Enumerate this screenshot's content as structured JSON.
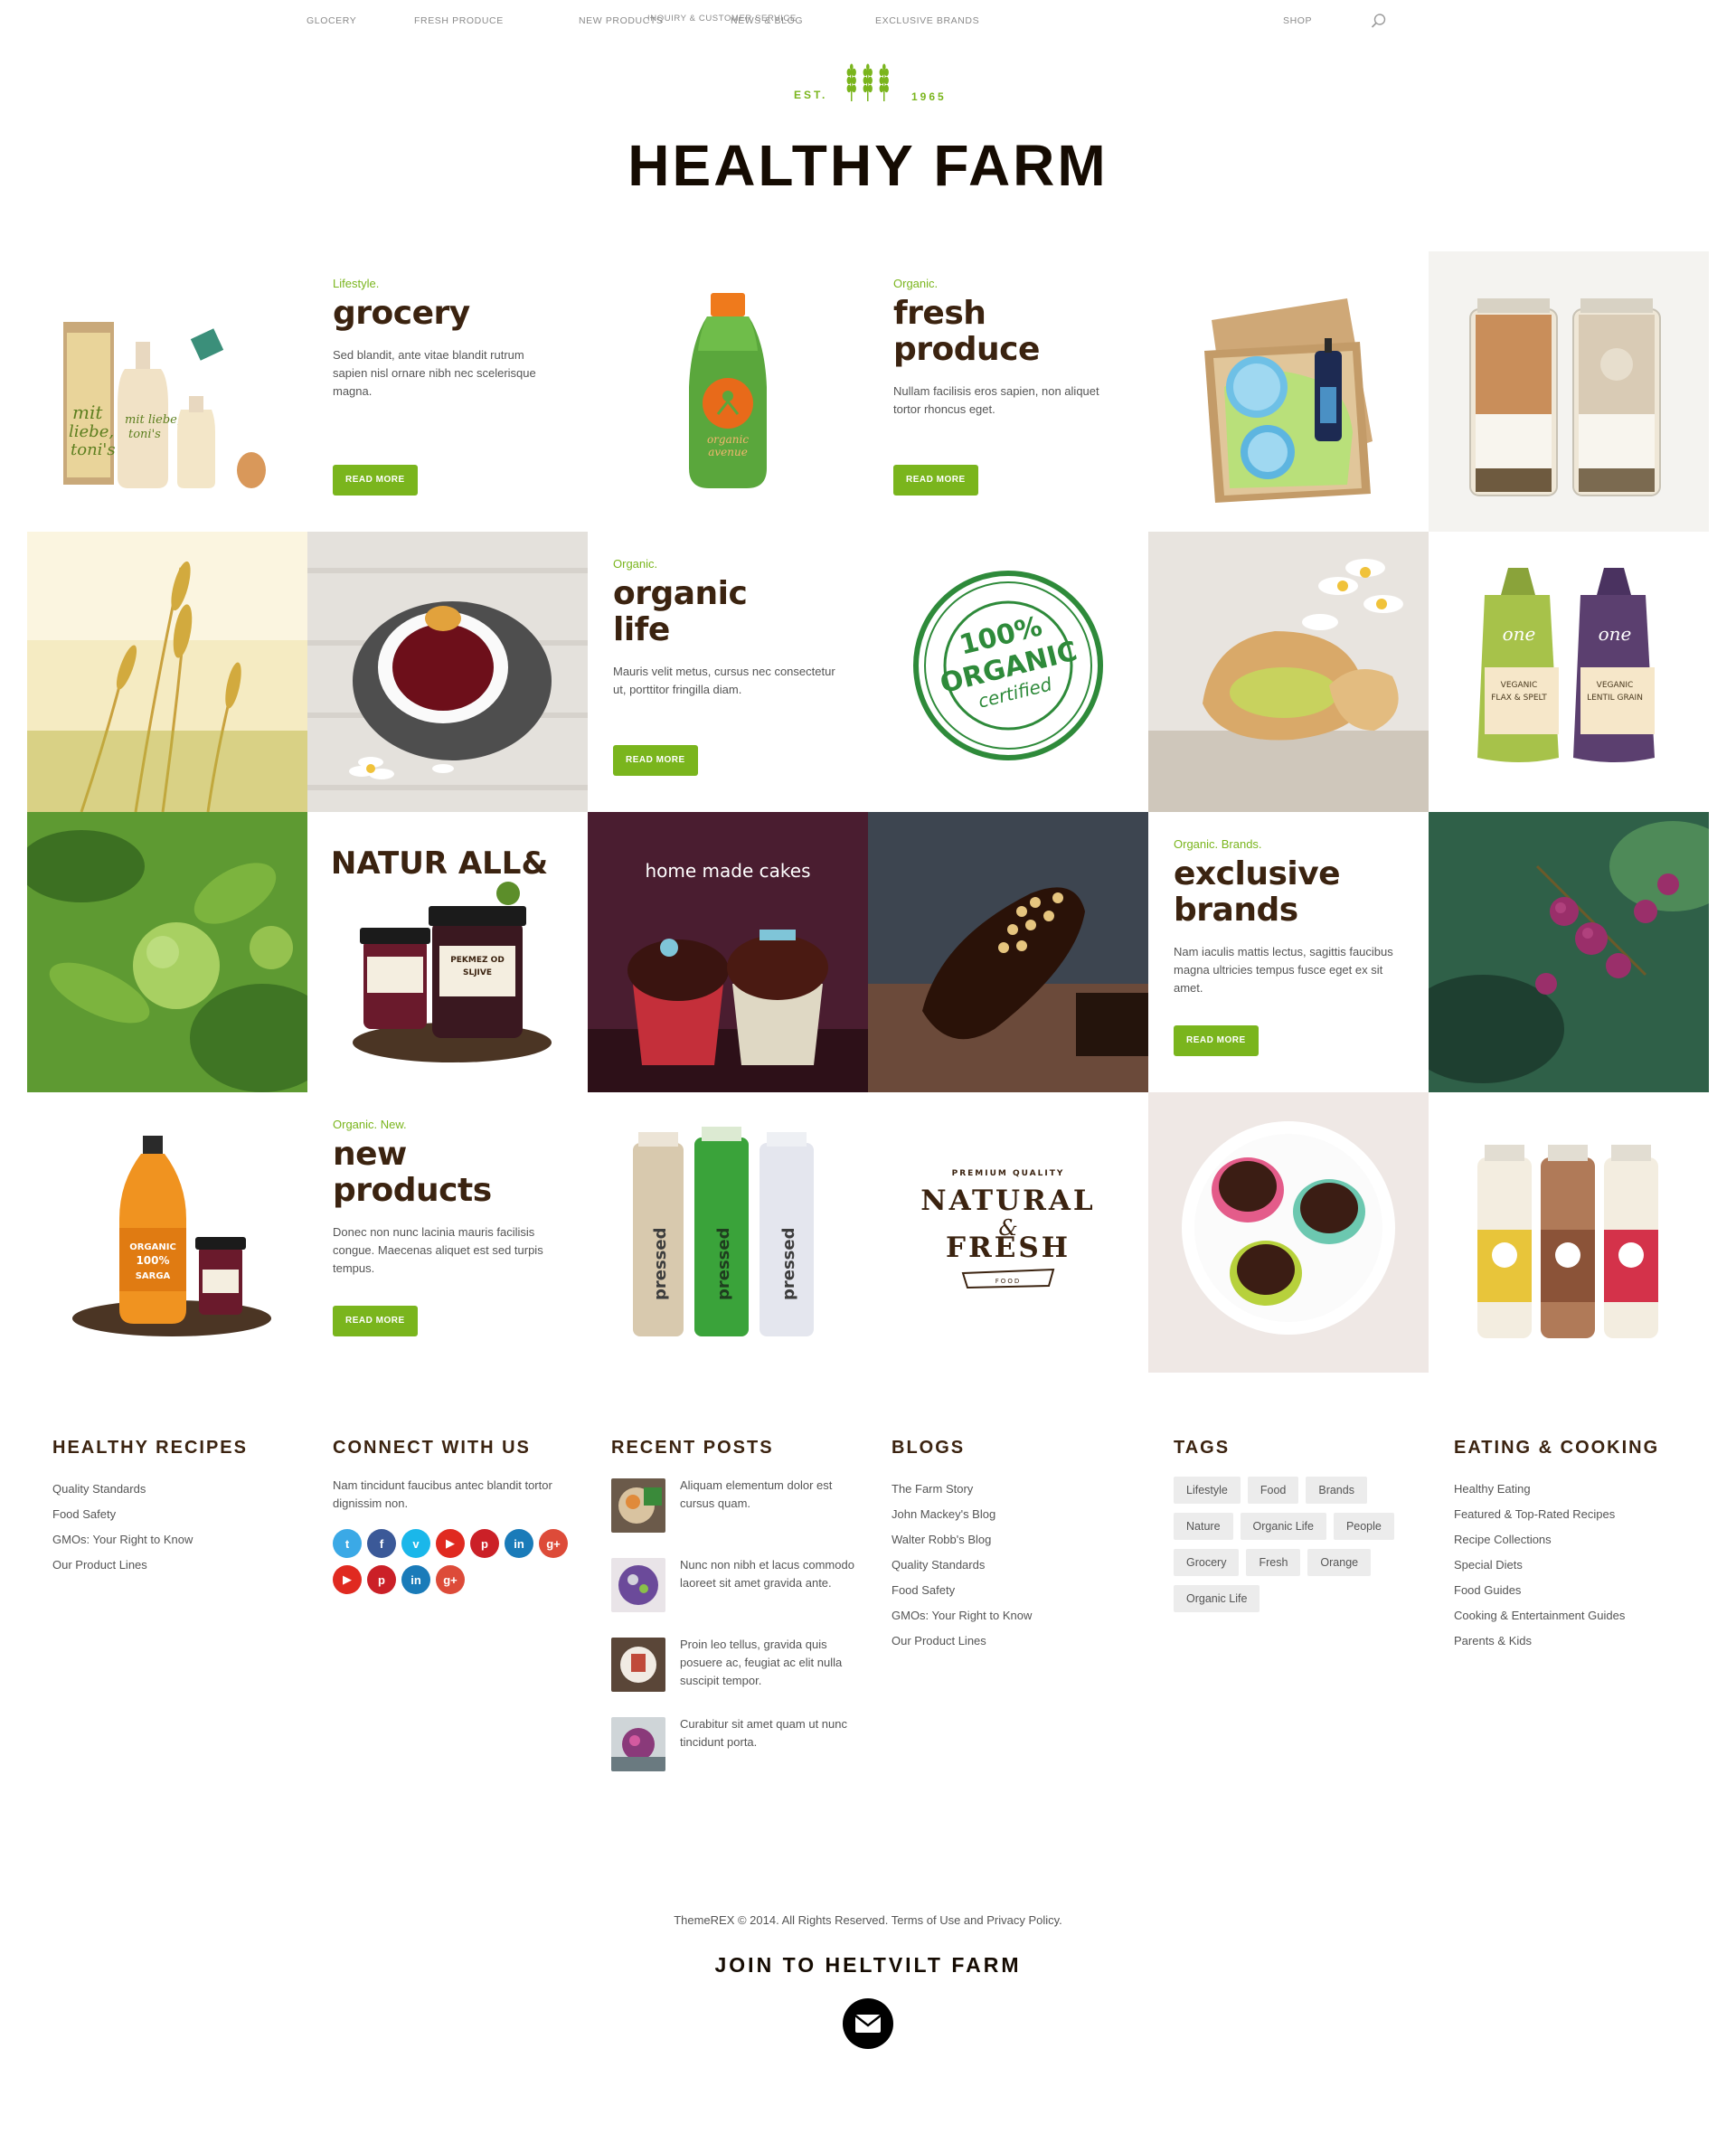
{
  "nav": {
    "items": [
      "GLOCERY",
      "FRESH PRODUCE",
      "NEW PRODUCTS",
      "INQUIRY & CUSTOMER SERVICE",
      "NEWS & BLOG",
      "EXCLUSIVE BRANDS",
      "SHOP"
    ]
  },
  "logo": {
    "est_left": "EST.",
    "est_right": "1965",
    "title": "HEALTHY FARM"
  },
  "tiles": {
    "grocery": {
      "kicker": "Lifestyle.",
      "title": "grocery",
      "text": "Sed blandit, ante vitae blandit rutrum sapien nisl ornare nibh nec scelerisque magna.",
      "button": "READ MORE"
    },
    "fresh_produce": {
      "kicker": "Organic.",
      "title": "fresh produce",
      "text": "Nullam facilisis eros sapien, non aliquet tortor rhoncus eget.",
      "button": "READ MORE"
    },
    "organic_life": {
      "kicker": "Organic.",
      "title": "organic life",
      "text": "Mauris velit metus, cursus nec consectetur ut, porttitor fringilla diam.",
      "button": "READ MORE"
    },
    "exclusive_brands": {
      "kicker": "Organic. Brands.",
      "title": "exclusive brands",
      "text": "Nam iaculis mattis lectus, sagittis faucibus magna ultricies tempus fusce eget ex sit amet.",
      "button": "READ MORE"
    },
    "new_products": {
      "kicker": "Organic. New.",
      "title": "new products",
      "text": "Donec non nunc lacinia mauris facilisis congue. Maecenas aliquet est sed turpis tempus.",
      "button": "READ MORE"
    }
  },
  "images": {
    "organic_stamp": "100% ORGANIC certified",
    "home_made_cakes": "home made cakes",
    "natur_all": "NATUR ALL&",
    "natural_fresh_top": "PREMIUM QUALITY",
    "natural_fresh_1": "NATURAL",
    "natural_fresh_amp": "&",
    "natural_fresh_2": "FRESH",
    "natural_fresh_bottom": "FOOD"
  },
  "footer": {
    "recipes": {
      "title": "HEALTHY RECIPES",
      "items": [
        "Quality Standards",
        "Food Safety",
        "GMOs: Your Right to Know",
        "Our Product Lines"
      ]
    },
    "connect": {
      "title": "CONNECT WITH US",
      "text": "Nam tincidunt faucibus antec blandit tortor dignissim non.",
      "icons": [
        {
          "name": "twitter-icon",
          "glyph": "t",
          "color": "#3ba9e6"
        },
        {
          "name": "facebook-icon",
          "glyph": "f",
          "color": "#3b5998"
        },
        {
          "name": "vimeo-icon",
          "glyph": "v",
          "color": "#1ab7ea"
        },
        {
          "name": "youtube-icon",
          "glyph": "▶",
          "color": "#e02a20"
        },
        {
          "name": "pinterest-icon",
          "glyph": "p",
          "color": "#cb2027"
        },
        {
          "name": "linkedin-icon",
          "glyph": "in",
          "color": "#1a7bb9"
        },
        {
          "name": "google-plus-icon",
          "glyph": "g+",
          "color": "#dd4b39"
        },
        {
          "name": "youtube-icon",
          "glyph": "▶",
          "color": "#e02a20"
        },
        {
          "name": "pinterest-icon",
          "glyph": "p",
          "color": "#cb2027"
        },
        {
          "name": "linkedin-icon",
          "glyph": "in",
          "color": "#1a7bb9"
        },
        {
          "name": "google-plus-icon",
          "glyph": "g+",
          "color": "#dd4b39"
        }
      ]
    },
    "recent_posts": {
      "title": "RECENT POSTS",
      "posts": [
        "Aliquam elementum dolor est cursus quam.",
        "Nunc non nibh et lacus commodo laoreet sit amet gravida ante.",
        "Proin leo tellus, gravida quis posuere ac, feugiat ac elit nulla suscipit tempor.",
        "Curabitur sit amet quam ut nunc tincidunt porta."
      ]
    },
    "blogs": {
      "title": "BLOGS",
      "items": [
        "The Farm Story",
        "John Mackey's Blog",
        "Walter Robb's Blog",
        "Quality Standards",
        "Food Safety",
        "GMOs: Your Right to Know",
        "Our Product Lines"
      ]
    },
    "tags": {
      "title": "TAGS",
      "items": [
        "Lifestyle",
        "Food",
        "Brands",
        "Nature",
        "Organic Life",
        "People",
        "Grocery",
        "Fresh",
        "Orange",
        "Organic Life"
      ]
    },
    "eating": {
      "title": "EATING & COOKING",
      "items": [
        "Healthy Eating",
        "Featured & Top-Rated Recipes",
        "Recipe Collections",
        "Special Diets",
        "Food Guides",
        "Cooking & Entertainment Guides",
        "Parents & Kids"
      ]
    }
  },
  "bottom": {
    "copyright": "ThemeREX © 2014. All Rights Reserved. Terms of Use and Privacy Policy.",
    "join": "JOIN TO HELTVILT FARM"
  },
  "colors": {
    "accent": "#7ab51d",
    "heading": "#3b2310"
  }
}
